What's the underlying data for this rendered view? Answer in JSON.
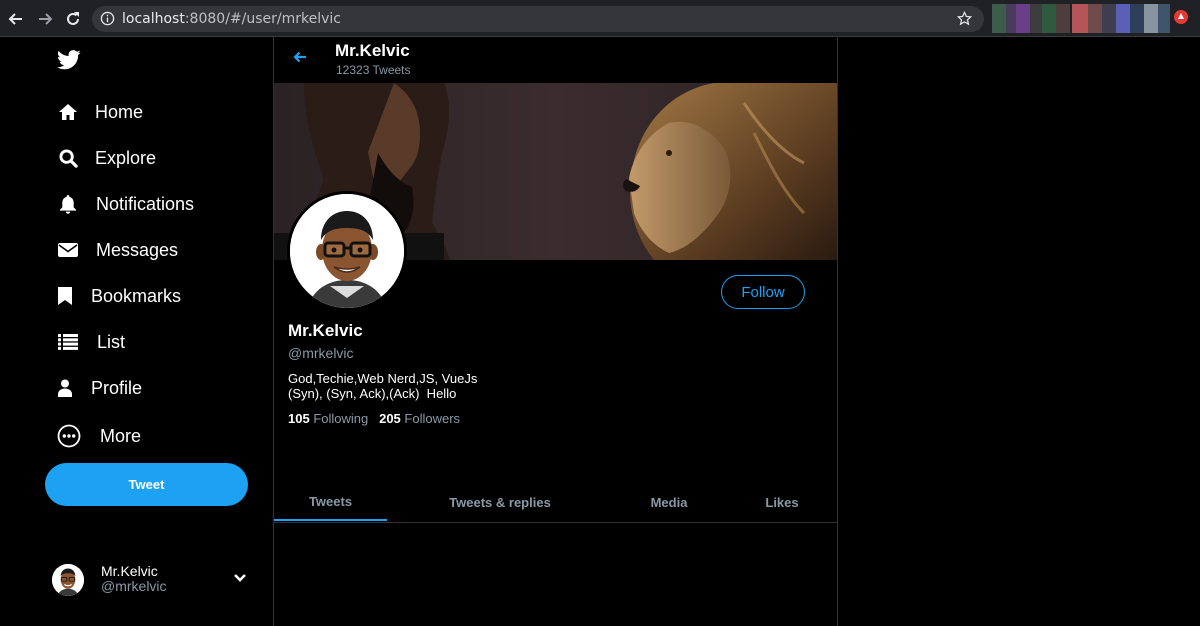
{
  "browser": {
    "url_host": "localhost",
    "url_rest": ":8080/#/user/mrkelvic"
  },
  "sidebar": {
    "items": [
      {
        "label": "Home",
        "icon": "home-icon"
      },
      {
        "label": "Explore",
        "icon": "search-icon"
      },
      {
        "label": "Notifications",
        "icon": "bell-icon"
      },
      {
        "label": "Messages",
        "icon": "envelope-icon"
      },
      {
        "label": "Bookmarks",
        "icon": "bookmark-icon"
      },
      {
        "label": "List",
        "icon": "list-icon"
      },
      {
        "label": "Profile",
        "icon": "person-icon"
      },
      {
        "label": "More",
        "icon": "more-icon"
      }
    ],
    "tweet_label": "Tweet",
    "account": {
      "name": "Mr.Kelvic",
      "handle": "@mrkelvic"
    }
  },
  "header": {
    "name": "Mr.Kelvic",
    "tweet_count": "12323 Tweets"
  },
  "profile": {
    "follow_label": "Follow",
    "name": "Mr.Kelvic",
    "handle": "@mrkelvic",
    "bio_line1": "God,Techie,Web Nerd,JS, VueJs",
    "bio_line2": "(Syn), (Syn, Ack),(Ack)  Hello",
    "following_count": "105",
    "following_label": "Following",
    "followers_count": "205",
    "followers_label": "Followers"
  },
  "tabs": [
    {
      "label": "Tweets",
      "active": true
    },
    {
      "label": "Tweets & replies",
      "active": false
    },
    {
      "label": "Media",
      "active": false
    },
    {
      "label": "Likes",
      "active": false
    }
  ],
  "colors": {
    "accent": "#1da1f2",
    "background": "#000000",
    "muted_text": "#8899a6",
    "border": "#2f3336"
  }
}
